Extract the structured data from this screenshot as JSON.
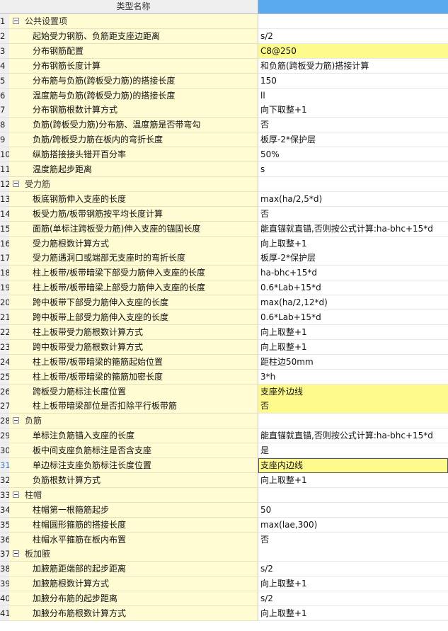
{
  "header": {
    "name_col": "类型名称"
  },
  "groups": [
    {
      "num": "1",
      "label": "公共设置项",
      "items": [
        {
          "num": "2",
          "name": "起始受力钢筋、负筋距支座边距离",
          "value": "s/2",
          "hl": false
        },
        {
          "num": "3",
          "name": "分布钢筋配置",
          "value": "C8@250",
          "hl": true
        },
        {
          "num": "4",
          "name": "分布钢筋长度计算",
          "value": "和负筋(跨板受力筋)搭接计算",
          "hl": false
        },
        {
          "num": "5",
          "name": "分布筋与负筋(跨板受力筋)的搭接长度",
          "value": "150",
          "hl": false
        },
        {
          "num": "6",
          "name": "温度筋与负筋(跨板受力筋)的搭接长度",
          "value": "ll",
          "hl": false
        },
        {
          "num": "7",
          "name": "分布钢筋根数计算方式",
          "value": "向下取整+1",
          "hl": false
        },
        {
          "num": "8",
          "name": "负筋(跨板受力筋)分布筋、温度筋是否带弯勾",
          "value": "否",
          "hl": false
        },
        {
          "num": "9",
          "name": "负筋/跨板受力筋在板内的弯折长度",
          "value": "板厚-2*保护层",
          "hl": false
        },
        {
          "num": "10",
          "name": "纵筋搭接接头错开百分率",
          "value": "50%",
          "hl": false
        },
        {
          "num": "11",
          "name": "温度筋起步距离",
          "value": "s",
          "hl": false
        }
      ]
    },
    {
      "num": "12",
      "label": "受力筋",
      "items": [
        {
          "num": "13",
          "name": "板底钢筋伸入支座的长度",
          "value": "max(ha/2,5*d)",
          "hl": false
        },
        {
          "num": "14",
          "name": "板受力筋/板带钢筋按平均长度计算",
          "value": "否",
          "hl": false
        },
        {
          "num": "15",
          "name": "面筋(单标注跨板受力筋)伸入支座的锚固长度",
          "value": "能直锚就直锚,否则按公式计算:ha-bhc+15*d",
          "hl": false
        },
        {
          "num": "16",
          "name": "受力筋根数计算方式",
          "value": "向上取整+1",
          "hl": false
        },
        {
          "num": "17",
          "name": "受力筋遇洞口或端部无支座时的弯折长度",
          "value": "板厚-2*保护层",
          "hl": false
        },
        {
          "num": "18",
          "name": "柱上板带/板带暗梁下部受力筋伸入支座的长度",
          "value": "ha-bhc+15*d",
          "hl": false
        },
        {
          "num": "19",
          "name": "柱上板带/板带暗梁上部受力筋伸入支座的长度",
          "value": "0.6*Lab+15*d",
          "hl": false
        },
        {
          "num": "20",
          "name": "跨中板带下部受力筋伸入支座的长度",
          "value": "max(ha/2,12*d)",
          "hl": false
        },
        {
          "num": "21",
          "name": "跨中板带上部受力筋伸入支座的长度",
          "value": "0.6*Lab+15*d",
          "hl": false
        },
        {
          "num": "22",
          "name": "柱上板带受力筋根数计算方式",
          "value": "向上取整+1",
          "hl": false
        },
        {
          "num": "23",
          "name": "跨中板带受力筋根数计算方式",
          "value": "向上取整+1",
          "hl": false
        },
        {
          "num": "24",
          "name": "柱上板带/板带暗梁的箍筋起始位置",
          "value": "距柱边50mm",
          "hl": false
        },
        {
          "num": "25",
          "name": "柱上板带/板带暗梁的箍筋加密长度",
          "value": "3*h",
          "hl": false
        },
        {
          "num": "26",
          "name": "跨板受力筋标注长度位置",
          "value": "支座外边线",
          "hl": true
        },
        {
          "num": "27",
          "name": "柱上板带暗梁部位是否扣除平行板带筋",
          "value": "否",
          "hl": true
        }
      ]
    },
    {
      "num": "28",
      "label": "负筋",
      "items": [
        {
          "num": "29",
          "name": "单标注负筋锚入支座的长度",
          "value": "能直锚就直锚,否则按公式计算:ha-bhc+15*d",
          "hl": false
        },
        {
          "num": "30",
          "name": "板中间支座负筋标注是否含支座",
          "value": "是",
          "hl": false
        },
        {
          "num": "31",
          "name": "单边标注支座负筋标注长度位置",
          "value": "支座内边线",
          "hl": true,
          "active": true
        },
        {
          "num": "32",
          "name": "负筋根数计算方式",
          "value": "向上取整+1",
          "hl": false
        }
      ]
    },
    {
      "num": "33",
      "label": "柱帽",
      "items": [
        {
          "num": "34",
          "name": "柱帽第一根箍筋起步",
          "value": "50",
          "hl": false
        },
        {
          "num": "35",
          "name": "柱帽圆形箍筋的搭接长度",
          "value": "max(lae,300)",
          "hl": false
        },
        {
          "num": "36",
          "name": "柱帽水平箍筋在板内布置",
          "value": "否",
          "hl": false
        }
      ]
    },
    {
      "num": "37",
      "label": "板加腋",
      "items": [
        {
          "num": "38",
          "name": "加腋筋距端部的起步距离",
          "value": "s/2",
          "hl": false
        },
        {
          "num": "39",
          "name": "加腋筋根数计算方式",
          "value": "向上取整+1",
          "hl": false
        },
        {
          "num": "40",
          "name": "加腋分布筋的起步距离",
          "value": "s/2",
          "hl": false
        },
        {
          "num": "41",
          "name": "加腋分布筋根数计算方式",
          "value": "向上取整+1",
          "hl": false
        }
      ]
    }
  ]
}
